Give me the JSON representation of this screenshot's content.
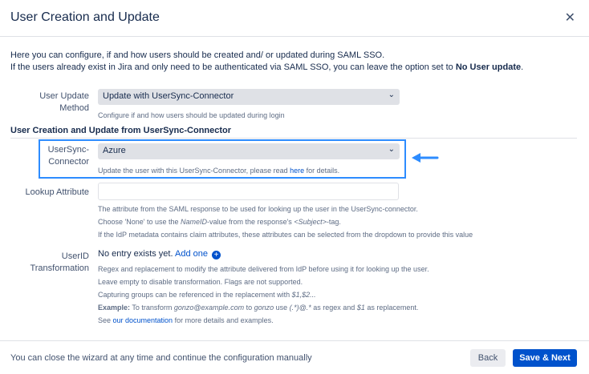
{
  "dialog": {
    "title": "User Creation and Update",
    "close_symbol": "✕"
  },
  "intro": {
    "line1": "Here you can configure, if and how users should be created and/ or updated during SAML SSO.",
    "line2_prefix": "If the users already exist in Jira and only need to be authenticated via SAML SSO, you can leave the option set to ",
    "line2_bold": "No User update",
    "line2_suffix": "."
  },
  "user_update_method": {
    "label_line1": "User Update",
    "label_line2": "Method",
    "value": "Update with UserSync-Connector",
    "help": "Configure if and how users should be updated during login"
  },
  "section": {
    "title": "User Creation and Update from UserSync-Connector"
  },
  "usersync_connector": {
    "label_line1": "UserSync-",
    "label_line2": "Connector",
    "value": "Azure",
    "help_prefix": "Update the user with this UserSync-Connector, please read ",
    "help_link": "here",
    "help_suffix": " for details."
  },
  "lookup_attribute": {
    "label": "Lookup Attribute",
    "value": "",
    "help_line1": "The attribute from the SAML response to be used for looking up the user in the UserSync-connector.",
    "help_line2_prefix": "Choose 'None' to use the ",
    "help_line2_em1": "NameID",
    "help_line2_mid": "-value from the response's ",
    "help_line2_em2": "<Subject>",
    "help_line2_suffix": "-tag.",
    "help_line3": "If the IdP metadata contains claim attributes, these attributes can be selected from the dropdown to provide this value"
  },
  "userid_transformation": {
    "label_line1": "UserID",
    "label_line2": "Transformation",
    "no_entry": "No entry exists yet.",
    "add_link": "Add one",
    "help_line1": "Regex and replacement to modify the attribute delivered from IdP before using it for looking up the user.",
    "help_line2": "Leave empty to disable transformation. Flags are not supported.",
    "help_line3_prefix": "Capturing groups can be referenced in the replacement with ",
    "help_line3_em": "$1,$2...",
    "help_line4_bold": "Example:",
    "help_line4_a": " To transform ",
    "help_line4_em1": "gonzo@example.com",
    "help_line4_b": " to ",
    "help_line4_em2": "gonzo",
    "help_line4_c": " use ",
    "help_line4_em3": "(.*)@.*",
    "help_line4_d": " as regex and ",
    "help_line4_em4": "$1",
    "help_line4_e": " as replacement.",
    "help_line5_prefix": "See ",
    "help_line5_link": "our documentation",
    "help_line5_suffix": " for more details and examples."
  },
  "footer": {
    "text": "You can close the wizard at any time and continue the configuration manually",
    "back_label": "Back",
    "next_label": "Save & Next"
  },
  "colors": {
    "primary": "#0052cc",
    "highlight": "#2d8cff"
  }
}
